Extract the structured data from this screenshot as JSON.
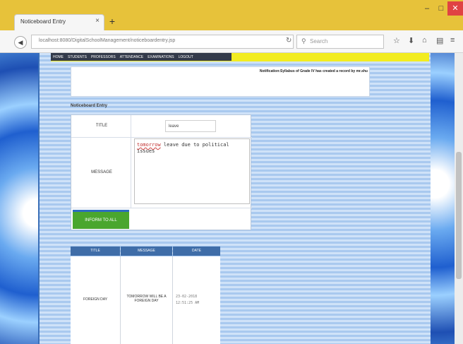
{
  "browser": {
    "tab_title": "Noticeboard Entry",
    "tab_close": "×",
    "new_tab": "+",
    "url": "localhost:8080/DigitalSchoolManagement/noticeboardentry.jsp",
    "search_placeholder": "Search",
    "window_buttons": {
      "minimize": "–",
      "maximize": "□",
      "close": "✕"
    }
  },
  "page": {
    "menu_items": [
      "HOME",
      "STUDENTS",
      "PROFESSORS",
      "ATTENDANCE",
      "EXAMINATIONS",
      "LOGOUT"
    ],
    "notification": "Notification:Syllabus of Grade IV has created a record by mr.shu",
    "section_title": "Noticeboard Entry",
    "form": {
      "title_label": "TITLE",
      "title_value": "leave",
      "message_label": "MESSAGE",
      "message_value_underlined": "tomorrow",
      "message_value_rest": " leave due to political issues",
      "inform_button": "INFORM TO ALL"
    },
    "table": {
      "headers": [
        "TITLE",
        "MESSAGE",
        "DATE"
      ],
      "rows": [
        {
          "title": "FOREIGN DAY",
          "message": "TOMORROW WILL BE A FOREIGN DAY",
          "date_line1": "23-02-2018",
          "date_line2": "12:51:25 AM"
        }
      ]
    }
  },
  "colors": {
    "menubar": "#f2ec20",
    "menu_bg": "#333a4a",
    "inform_button": "#4aa62e",
    "table_header": "#3f6da8",
    "title_bar": "#e7c23a"
  }
}
